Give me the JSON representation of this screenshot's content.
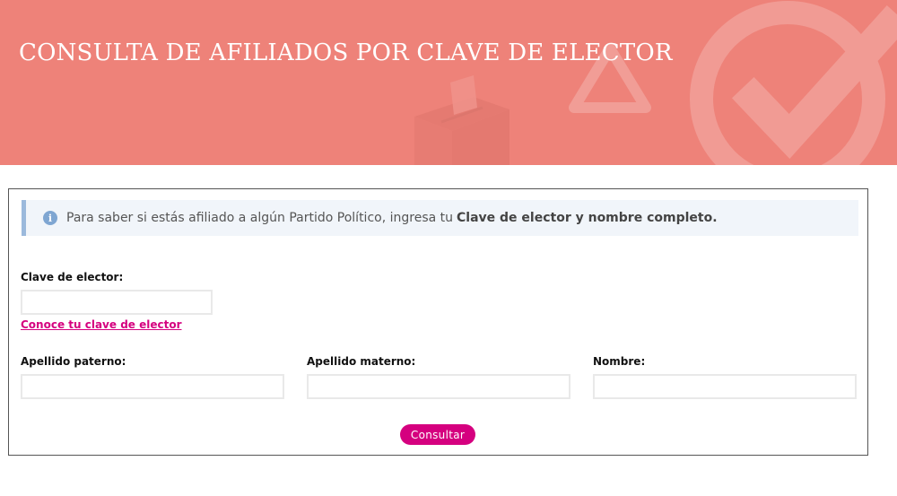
{
  "banner": {
    "title": "CONSULTA DE AFILIADOS POR CLAVE DE ELECTOR",
    "background_color": "#ee8279"
  },
  "info": {
    "icon": "info-circle-icon",
    "text": "Para saber si estás afiliado a algún Partido Político, ingresa tu",
    "bold_text": "Clave de elector y nombre completo."
  },
  "form": {
    "clave_label": "Clave de elector:",
    "clave_value": "",
    "clave_link": "Conoce tu clave de elector",
    "paterno_label": "Apellido paterno:",
    "paterno_value": "",
    "materno_label": "Apellido materno:",
    "materno_value": "",
    "nombre_label": "Nombre:",
    "nombre_value": "",
    "submit_label": "Consultar"
  },
  "colors": {
    "accent": "#d5007f",
    "info_border": "#9bb9dc",
    "info_background": "#f1f5fa"
  }
}
